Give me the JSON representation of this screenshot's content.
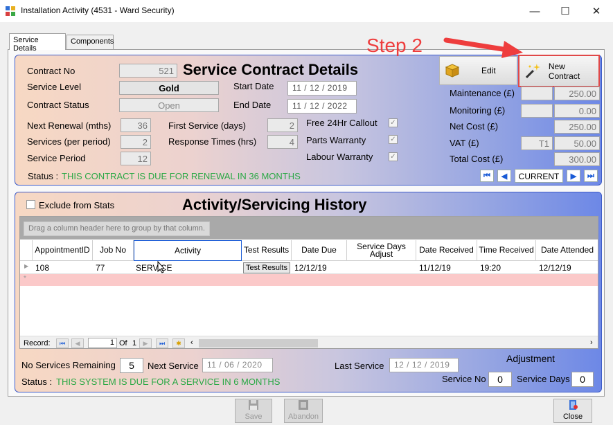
{
  "window": {
    "title": "Installation Activity (4531 - Ward Security)",
    "minimize": "—",
    "maximize": "☐",
    "close": "✕"
  },
  "tabs": [
    {
      "label": "Service Details",
      "active": true
    },
    {
      "label": "Components",
      "active": false
    }
  ],
  "annotation": {
    "text": "Step 2",
    "color": "#ee3d3d"
  },
  "contract": {
    "heading": "Service Contract Details",
    "contract_no_label": "Contract No",
    "contract_no": "521",
    "service_level_label": "Service Level",
    "service_level": "Gold",
    "contract_status_label": "Contract Status",
    "contract_status": "Open",
    "start_date_label": "Start Date",
    "start_date": "11 / 12 / 2019",
    "end_date_label": "End Date",
    "end_date": "11 / 12 / 2022",
    "next_renewal_label": "Next Renewal (mths)",
    "next_renewal": "36",
    "services_per_period_label": "Services (per period)",
    "services_per_period": "2",
    "service_period_label": "Service Period",
    "service_period": "12",
    "first_service_label": "First Service (days)",
    "first_service": "2",
    "response_times_label": "Response Times (hrs)",
    "response_times": "4",
    "free_callout_label": "Free 24Hr Callout",
    "parts_warranty_label": "Parts Warranty",
    "labour_warranty_label": "Labour Warranty",
    "check_mark": "✓",
    "status_label": "Status :",
    "status_text": "THIS CONTRACT IS DUE FOR RENEWAL IN 36 MONTHS"
  },
  "toolbar": {
    "edit_label": "Edit",
    "new_contract_label": "New Contract"
  },
  "costs": {
    "maintenance_label": "Maintenance (£)",
    "maintenance": "250.00",
    "monitoring_label": "Monitoring (£)",
    "monitoring": "0.00",
    "net_cost_label": "Net Cost (£)",
    "net_cost": "250.00",
    "vat_label": "VAT (£)",
    "vat_code": "T1",
    "vat": "50.00",
    "total_cost_label": "Total Cost (£)",
    "total_cost": "300.00"
  },
  "nav": {
    "first": "⏮",
    "prev": "◀",
    "current_label": "CURRENT",
    "next": "▶",
    "last": "⏭"
  },
  "history": {
    "heading": "Activity/Servicing History",
    "exclude_label": "Exclude from Stats",
    "group_hint": "Drag a column header here to group by that column.",
    "columns": [
      "AppointmentID",
      "Job No",
      "Activity",
      "Test Results",
      "Date Due",
      "Service Days Adjust",
      "Date Received",
      "Time Received",
      "Date Attended"
    ],
    "rows": [
      {
        "appointment_id": "108",
        "job_no": "77",
        "activity": "SERVICE",
        "test_results": "Test Results",
        "date_due": "12/12/19",
        "service_days_adjust": "",
        "date_received": "11/12/19",
        "time_received": "19:20",
        "date_attended": "12/12/19"
      }
    ],
    "new_row_marker": "*",
    "record_label": "Record:",
    "record_value": "1",
    "of_label": "Of",
    "of_value": "1"
  },
  "summary": {
    "no_services_remaining_label": "No Services Remaining",
    "no_services_remaining": "5",
    "next_service_label": "Next Service",
    "next_service": "11 / 06 / 2020",
    "last_service_label": "Last Service",
    "last_service": "12 / 12 / 2019",
    "adjustment_label": "Adjustment",
    "service_no_label": "Service No",
    "service_no": "0",
    "service_days_label": "Service Days",
    "service_days": "0",
    "status_label": "Status :",
    "status_text": "THIS SYSTEM IS DUE FOR A SERVICE IN 6 MONTHS"
  },
  "bottom": {
    "save_label": "Save",
    "abandon_label": "Abandon",
    "close_label": "Close"
  }
}
